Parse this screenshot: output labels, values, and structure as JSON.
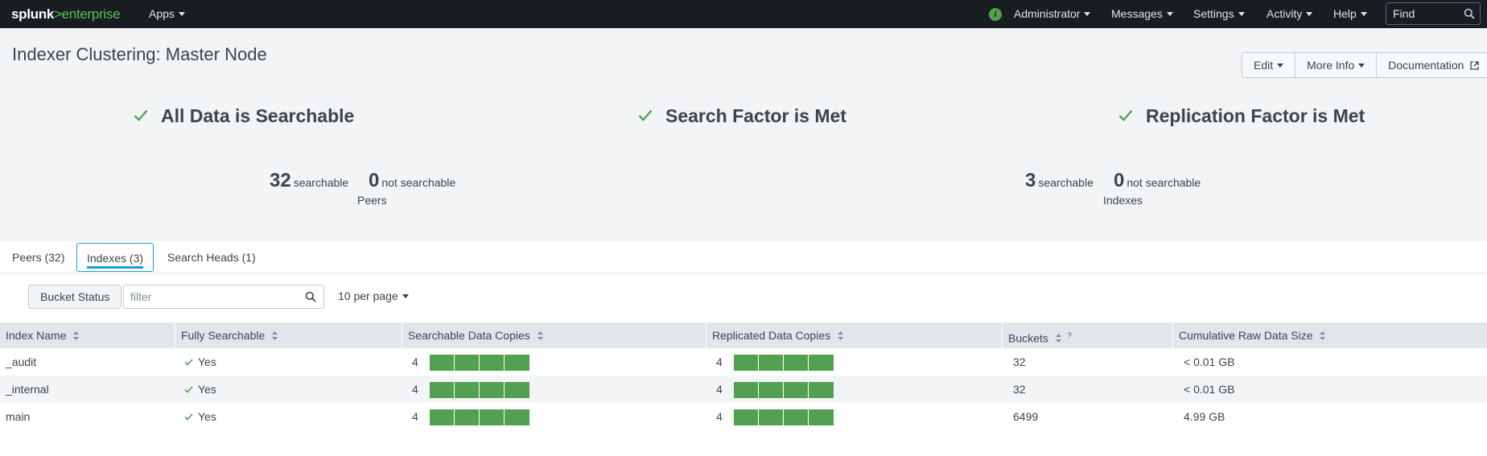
{
  "topbar": {
    "logo": {
      "splunk": "splunk",
      "gt": ">",
      "enterprise": "enterprise"
    },
    "apps_label": "Apps",
    "health_icon": "info-circle-icon",
    "health_glyph": "i",
    "user_label": "Administrator",
    "messages_label": "Messages",
    "settings_label": "Settings",
    "activity_label": "Activity",
    "help_label": "Help",
    "find_placeholder": "Find",
    "colors": {
      "background": "#171d21",
      "brand_green": "#5cc05c"
    }
  },
  "page": {
    "title": "Indexer Clustering: Master Node",
    "buttons": {
      "edit": "Edit",
      "more_info": "More Info",
      "documentation": "Documentation"
    }
  },
  "status": {
    "items": [
      {
        "label": "All Data is Searchable",
        "icon": "check-icon"
      },
      {
        "label": "Search Factor is Met",
        "icon": "check-icon"
      },
      {
        "label": "Replication Factor is Met",
        "icon": "check-icon"
      }
    ],
    "peers": {
      "searchable_count": "32",
      "searchable_label": "searchable",
      "not_searchable_count": "0",
      "not_searchable_label": "not searchable",
      "caption": "Peers"
    },
    "indexes": {
      "searchable_count": "3",
      "searchable_label": "searchable",
      "not_searchable_count": "0",
      "not_searchable_label": "not searchable",
      "caption": "Indexes"
    },
    "colors": {
      "ok_green": "#53a051"
    }
  },
  "tabs": [
    {
      "label": "Peers (32)",
      "active": false
    },
    {
      "label": "Indexes (3)",
      "active": true
    },
    {
      "label": "Search Heads (1)",
      "active": false
    }
  ],
  "controls": {
    "bucket_status_label": "Bucket Status",
    "filter_placeholder": "filter",
    "per_page_label": "10 per page"
  },
  "table": {
    "columns": [
      "Index Name",
      "Fully Searchable",
      "Searchable Data Copies",
      "Replicated Data Copies",
      "Buckets",
      "Cumulative Raw Data Size"
    ],
    "buckets_help": "?",
    "rows": [
      {
        "index_name": "_audit",
        "fully_searchable": "Yes",
        "searchable_copies": "4",
        "replicated_copies": "4",
        "buckets": "32",
        "raw_size": "< 0.01 GB"
      },
      {
        "index_name": "_internal",
        "fully_searchable": "Yes",
        "searchable_copies": "4",
        "replicated_copies": "4",
        "buckets": "32",
        "raw_size": "< 0.01 GB"
      },
      {
        "index_name": "main",
        "fully_searchable": "Yes",
        "searchable_copies": "4",
        "replicated_copies": "4",
        "buckets": "6499",
        "raw_size": "4.99 GB"
      }
    ],
    "colors": {
      "copy_bar": "#53a051",
      "header_bg": "#e1e6eb"
    }
  }
}
